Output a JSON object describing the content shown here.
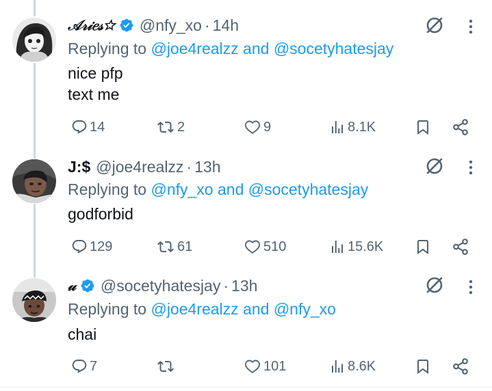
{
  "colors": {
    "accent": "#1d9bf0",
    "muted": "#536471",
    "text": "#0f1419",
    "thread": "#cfd9de"
  },
  "tweets": [
    {
      "display_name": "𝒜𝓇𝒾𝑒𝓈☆",
      "verified": true,
      "handle": "@nfy_xo",
      "time": "14h",
      "replying_prefix": "Replying to",
      "mention_1": "@joe4realzz",
      "and": "and",
      "mention_2": "@socetyhatesjay",
      "text": "nice pfp\ntext me",
      "replies": "14",
      "reposts": "2",
      "likes": "9",
      "views": "8.1K",
      "avatar": "bw-anime-girl"
    },
    {
      "display_name": "J:$",
      "verified": false,
      "handle": "@joe4realzz",
      "time": "13h",
      "replying_prefix": "Replying to",
      "mention_1": "@nfy_xo",
      "and": "and",
      "mention_2": "@socetyhatesjay",
      "text": "godforbid",
      "replies": "129",
      "reposts": "61",
      "likes": "510",
      "views": "15.6K",
      "avatar": "person-photo"
    },
    {
      "display_name": "𝓊",
      "verified": true,
      "handle": "@socetyhatesjay",
      "time": "13h",
      "replying_prefix": "Replying to",
      "mention_1": "@joe4realzz",
      "and": "and",
      "mention_2": "@nfy_xo",
      "text": "chai",
      "replies": "7",
      "reposts": "",
      "likes": "101",
      "views": "8.6K",
      "avatar": "person-bandana"
    }
  ],
  "icons": [
    "verified-badge-icon",
    "grok-icon",
    "more-icon",
    "reply-icon",
    "repost-icon",
    "like-icon",
    "views-icon",
    "bookmark-icon",
    "share-icon"
  ]
}
